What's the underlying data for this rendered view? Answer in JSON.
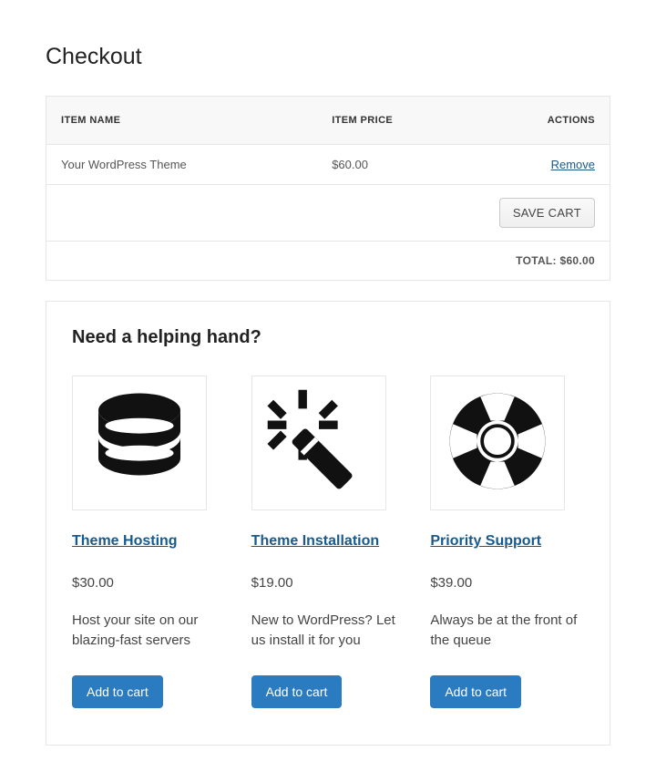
{
  "page_title": "Checkout",
  "table": {
    "headers": {
      "name": "ITEM NAME",
      "price": "ITEM PRICE",
      "actions": "ACTIONS"
    },
    "row": {
      "name": "Your WordPress Theme",
      "price": "$60.00",
      "remove_label": "Remove"
    },
    "save_cart_label": "SAVE CART",
    "total_label": "TOTAL: $60.00"
  },
  "upsell": {
    "title": "Need a helping hand?",
    "items": [
      {
        "name": "Theme Hosting",
        "price": "$30.00",
        "desc": "Host your site on our blazing-fast servers",
        "cta": "Add to cart"
      },
      {
        "name": "Theme Installation",
        "price": "$19.00",
        "desc": "New to WordPress? Let us install it for you",
        "cta": "Add to cart"
      },
      {
        "name": "Priority Support",
        "price": "$39.00",
        "desc": "Always be at the front of the queue",
        "cta": "Add to cart"
      }
    ]
  }
}
